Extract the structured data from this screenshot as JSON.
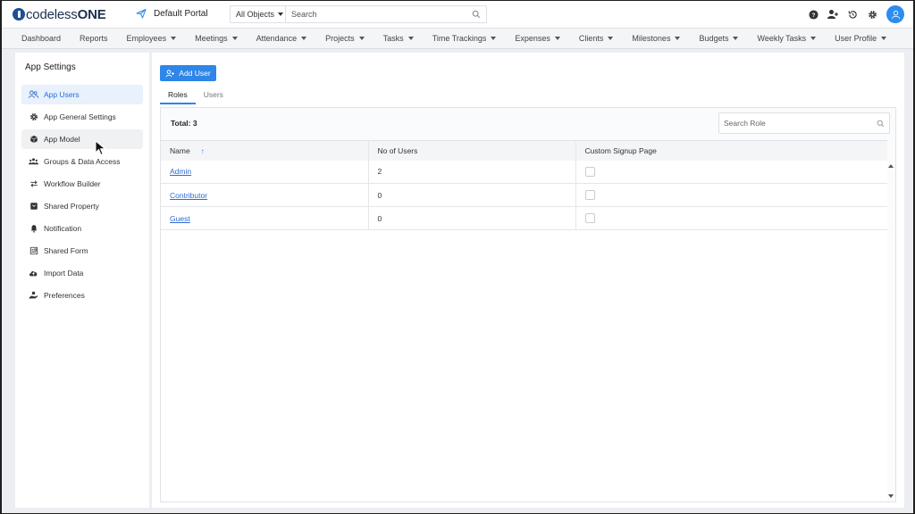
{
  "app": {
    "logo_prefix": "codeless",
    "logo_suffix": "ONE",
    "portal_name": "Default Portal"
  },
  "search": {
    "scope": "All Objects",
    "placeholder": "Search"
  },
  "top_icons": [
    "help-icon",
    "add-user-icon",
    "history-icon",
    "settings-icon",
    "user-avatar-icon"
  ],
  "nav": {
    "items": [
      {
        "label": "Dashboard",
        "dropdown": false
      },
      {
        "label": "Reports",
        "dropdown": false
      },
      {
        "label": "Employees",
        "dropdown": true
      },
      {
        "label": "Meetings",
        "dropdown": true
      },
      {
        "label": "Attendance",
        "dropdown": true
      },
      {
        "label": "Projects",
        "dropdown": true
      },
      {
        "label": "Tasks",
        "dropdown": true
      },
      {
        "label": "Time Trackings",
        "dropdown": true
      },
      {
        "label": "Expenses",
        "dropdown": true
      },
      {
        "label": "Clients",
        "dropdown": true
      },
      {
        "label": "Milestones",
        "dropdown": true
      },
      {
        "label": "Budgets",
        "dropdown": true
      },
      {
        "label": "Weekly Tasks",
        "dropdown": true
      },
      {
        "label": "User Profile",
        "dropdown": true
      }
    ]
  },
  "sidebar": {
    "title": "App Settings",
    "items": [
      {
        "label": "App Users",
        "icon": "users-icon",
        "state": "active"
      },
      {
        "label": "App General Settings",
        "icon": "gear-icon",
        "state": ""
      },
      {
        "label": "App Model",
        "icon": "cube-icon",
        "state": "hover"
      },
      {
        "label": "Groups & Data Access",
        "icon": "groups-icon",
        "state": ""
      },
      {
        "label": "Workflow Builder",
        "icon": "workflow-icon",
        "state": ""
      },
      {
        "label": "Shared Property",
        "icon": "shared-property-icon",
        "state": ""
      },
      {
        "label": "Notification",
        "icon": "bell-icon",
        "state": ""
      },
      {
        "label": "Shared Form",
        "icon": "form-icon",
        "state": ""
      },
      {
        "label": "Import Data",
        "icon": "cloud-upload-icon",
        "state": ""
      },
      {
        "label": "Preferences",
        "icon": "preferences-icon",
        "state": ""
      }
    ]
  },
  "main": {
    "add_user_label": "Add User",
    "tabs": [
      {
        "label": "Roles",
        "active": true
      },
      {
        "label": "Users",
        "active": false
      }
    ],
    "total_label": "Total: 3",
    "search_placeholder": "Search Role",
    "columns": [
      "Name",
      "No of Users",
      "Custom Signup Page"
    ],
    "rows": [
      {
        "name": "Admin",
        "users": "2",
        "custom_signup": false
      },
      {
        "name": "Contributor",
        "users": "0",
        "custom_signup": false
      },
      {
        "name": "Guest",
        "users": "0",
        "custom_signup": false
      }
    ]
  },
  "colors": {
    "accent": "#2d86e8",
    "active_bg": "#e8f1fc",
    "logo": "#1d4f91"
  }
}
